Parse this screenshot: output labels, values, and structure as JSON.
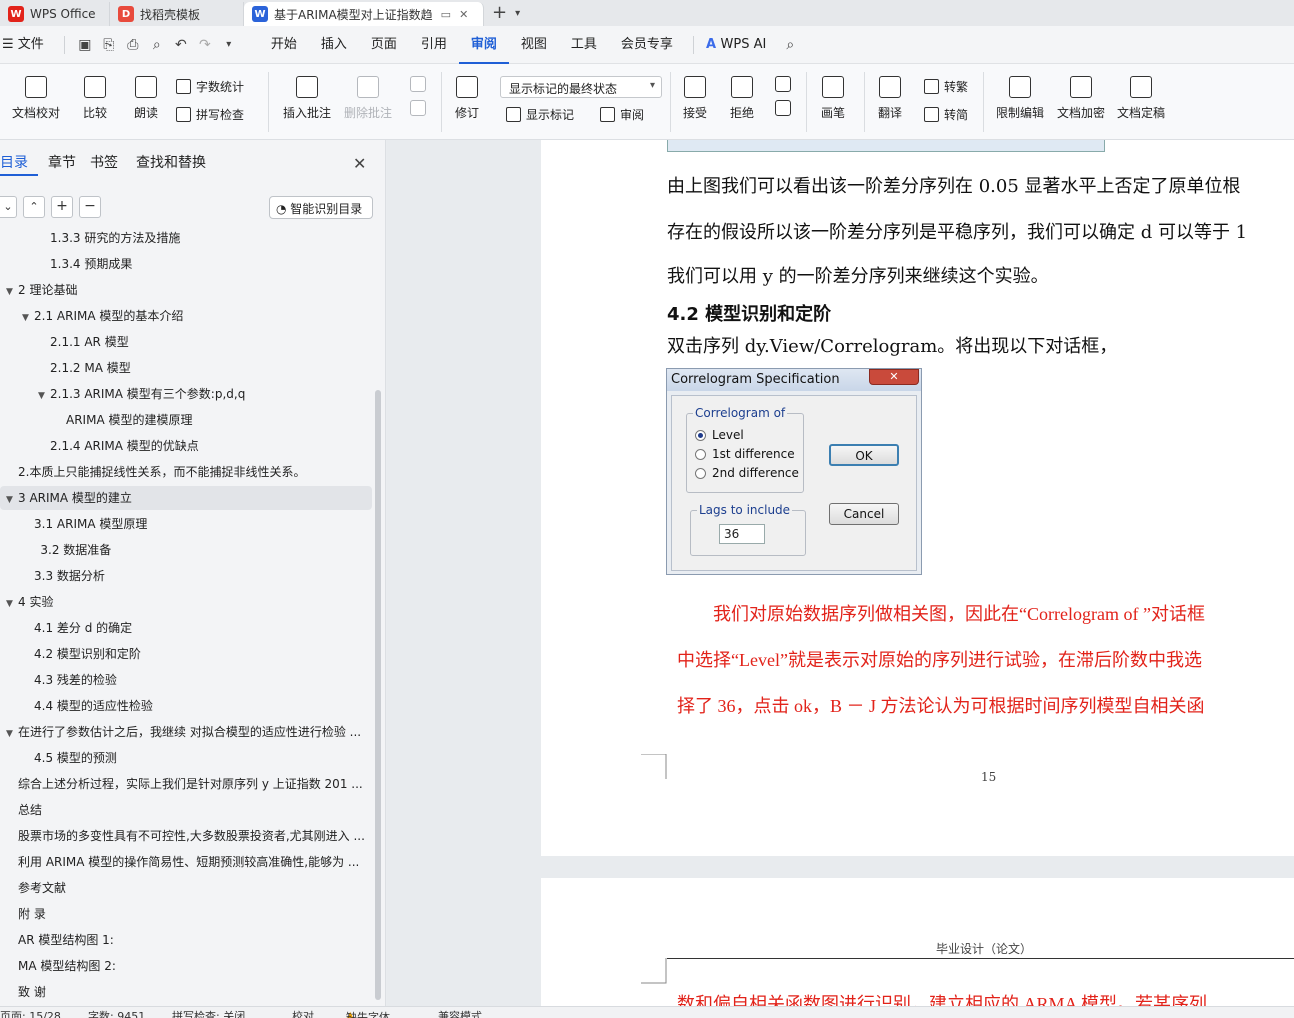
{
  "tabs": [
    {
      "label": "WPS Office",
      "icon": "wps-logo-icon"
    },
    {
      "label": "找稻壳模板",
      "icon": "docer-icon"
    },
    {
      "label": "基于ARIMA模型对上证指数趋",
      "icon": "word-doc-icon"
    }
  ],
  "menu": {
    "file": "文件",
    "items": [
      "开始",
      "插入",
      "页面",
      "引用",
      "审阅",
      "视图",
      "工具",
      "会员专享"
    ],
    "active": "审阅",
    "wps_ai": "WPS AI"
  },
  "ribbon": {
    "doc_check": "文档校对",
    "compare": "比较",
    "read_aloud": "朗读",
    "word_count": "字数统计",
    "spell_check": "拼写检查",
    "insert_comment": "插入批注",
    "delete_comment": "删除批注",
    "revise": "修订",
    "markup_state": "显示标记的最终状态",
    "show_markup": "显示标记",
    "review": "审阅",
    "accept": "接受",
    "reject": "拒绝",
    "pen": "画笔",
    "translate": "翻译",
    "to_traditional": "转繁",
    "to_simplified": "转简",
    "restrict_edit": "限制编辑",
    "doc_encrypt": "文档加密",
    "doc_finalize": "文档定稿"
  },
  "left_panel": {
    "tabs": [
      "目录",
      "章节",
      "书签",
      "查找和替换"
    ],
    "smart_toc": "智能识别目录",
    "toc": [
      {
        "label": "1.3.3 研究的方法及措施",
        "level": 2
      },
      {
        "label": "1.3.4 预期成果",
        "level": 2
      },
      {
        "label": "2 理论基础",
        "level": 0,
        "expanded": true
      },
      {
        "label": "2.1 ARIMA 模型的基本介绍",
        "level": 1,
        "expanded": true
      },
      {
        "label": "2.1.1    AR 模型",
        "level": 2
      },
      {
        "label": "2.1.2    MA 模型",
        "level": 2
      },
      {
        "label": "2.1.3 ARIMA 模型有三个参数:p,d,q",
        "level": 2,
        "expanded": true
      },
      {
        "label": "ARIMA 模型的建模原理",
        "level": 3
      },
      {
        "label": "2.1.4 ARIMA 模型的优缺点",
        "level": 2
      },
      {
        "label": "2.本质上只能捕捉线性关系，而不能捕捉非线性关系。",
        "level": 0
      },
      {
        "label": "3 ARIMA 模型的建立",
        "level": 0,
        "expanded": true,
        "selected": true
      },
      {
        "label": "3.1 ARIMA 模型原理",
        "level": 1
      },
      {
        "label": "3.2  数据准备",
        "level": 1.4
      },
      {
        "label": "3.3  数据分析",
        "level": 1
      },
      {
        "label": "4  实验",
        "level": 0,
        "expanded": true
      },
      {
        "label": "4.1  差分 d 的确定",
        "level": 1
      },
      {
        "label": "4.2 模型识别和定阶",
        "level": 1
      },
      {
        "label": "4.3  残差的检验",
        "level": 1
      },
      {
        "label": "4.4 模型的适应性检验",
        "level": 1
      },
      {
        "label": "在进行了参数估计之后，我继续 对拟合模型的适应性进行检验 ...",
        "level": 0,
        "expanded": true
      },
      {
        "label": "4.5 模型的预测",
        "level": 1
      },
      {
        "label": "综合上述分析过程，实际上我们是针对原序列 y 上证指数 201 ...",
        "level": 0
      },
      {
        "label": "总结",
        "level": 0
      },
      {
        "label": "股票市场的多变性具有不可控性,大多数股票投资者,尤其刚进入 ...",
        "level": 0
      },
      {
        "label": "利用 ARIMA 模型的操作简易性、短期预测较高准确性,能够为 ...",
        "level": 0
      },
      {
        "label": "参考文献",
        "level": 0
      },
      {
        "label": "附  录",
        "level": 0
      },
      {
        "label": "AR 模型结构图 1:",
        "level": 0
      },
      {
        "label": "MA 模型结构图 2:",
        "level": 0
      },
      {
        "label": "致  谢",
        "level": 0
      }
    ]
  },
  "document": {
    "lines": [
      "由上图我们可以看出该一阶差分序列在 0.05 显著水平上否定了原单位根",
      "存在的假设所以该一阶差分序列是平稳序列，我们可以确定 d 可以等于 1",
      "我们可以用 y 的一阶差分序列来继续这个实验。"
    ],
    "heading": "4.2 模型识别和定阶",
    "instruction": "双击序列 dy.View/Correlogram。将出现以下对话框，",
    "dialog": {
      "title": "Correlogram Specification",
      "group_label": "Correlogram of",
      "options": [
        "Level",
        "1st difference",
        "2nd difference"
      ],
      "selected": "Level",
      "lags_label": "Lags to include",
      "lags_value": "36",
      "ok": "OK",
      "cancel": "Cancel"
    },
    "red_lines": [
      "我们对原始数据序列做相关图，因此在“Correlogram of ”对话框",
      "中选择“Level”就是表示对原始的序列进行试验，在滞后阶数中我选",
      "择了 36，点击 ok，B － J 方法论认为可根据时间序列模型自相关函"
    ],
    "page_number": "15",
    "page2_header": "毕业设计（论文）",
    "page2_red": "数和偏自相关函数图进行识别，建立相应的 ARMA 模型。若某序列"
  },
  "status": {
    "page": "页面: 15/28",
    "words": "字数: 9451",
    "spell": "拼写检查: 关闭",
    "proof": "校对",
    "missing_font": "缺失字体",
    "compat": "兼容模式"
  },
  "colors": {
    "accent": "#1f5fd6",
    "red_text": "#e2231a"
  }
}
